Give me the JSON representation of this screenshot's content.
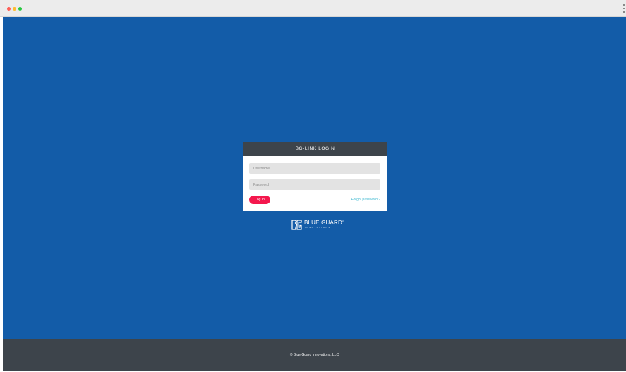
{
  "window": {
    "controls": [
      "close",
      "minimize",
      "zoom"
    ],
    "menu_icon": "vertical-dots-icon"
  },
  "login": {
    "title": "BG-LINK LOGIN",
    "username_placeholder": "Username",
    "password_placeholder": "Password",
    "login_button": "Log In",
    "forgot_password": "Forgot password ?"
  },
  "brand": {
    "name": "BLUE GUARD",
    "registered_mark": "®",
    "tagline": "INNOVATIONS",
    "logo_icon": "bg-monogram-icon"
  },
  "footer": {
    "copyright": "© Blue Guard Innovations, LLC"
  },
  "colors": {
    "background_blue": "#135ca8",
    "dark_gray": "#3d444b",
    "button_pink": "#f4174d",
    "link_teal": "#3db8d0"
  }
}
